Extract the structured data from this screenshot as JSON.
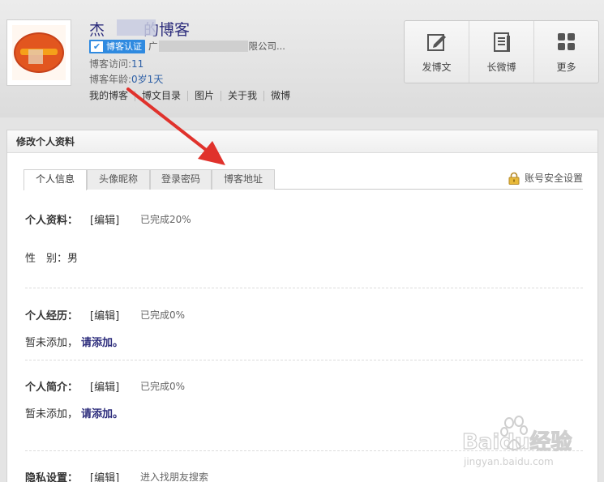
{
  "header": {
    "title_left": "杰",
    "title_right": "的博客",
    "verified_label": "博客认证",
    "company_prefix": "广",
    "company_suffix": "限公司...",
    "visits_label": "博客访问:",
    "visits_value": "11",
    "age_label": "博客年龄:",
    "age_value": "0岁1天",
    "nav": [
      "我的博客",
      "博文目录",
      "图片",
      "关于我",
      "微博"
    ],
    "actions": [
      {
        "label": "发博文",
        "icon": "edit-icon"
      },
      {
        "label": "长微博",
        "icon": "document-icon"
      },
      {
        "label": "更多",
        "icon": "grid-icon"
      }
    ]
  },
  "panel": {
    "title": "修改个人资料",
    "tabs": [
      "个人信息",
      "头像昵称",
      "登录密码",
      "博客地址"
    ],
    "active_tab": 0,
    "security_link": "账号安全设置"
  },
  "sections": {
    "profile": {
      "label": "个人资料：",
      "edit": "[编辑]",
      "progress": "已完成20%",
      "gender": "性　别：男"
    },
    "experience": {
      "label": "个人经历：",
      "edit": "[编辑]",
      "progress": "已完成0%",
      "empty": "暂未添加，",
      "add": "请添加。"
    },
    "intro": {
      "label": "个人简介：",
      "edit": "[编辑]",
      "progress": "已完成0%",
      "empty": "暂未添加，",
      "add": "请添加。"
    },
    "privacy": {
      "label": "隐私设置：",
      "edit": "[编辑]",
      "note": "进入找朋友搜索"
    }
  },
  "watermark": {
    "brand": "Baidu经验",
    "url": "jingyan.baidu.com"
  },
  "colors": {
    "accent": "#2d2d7c",
    "arrow": "#e0322c",
    "verified": "#2f8ae0"
  }
}
